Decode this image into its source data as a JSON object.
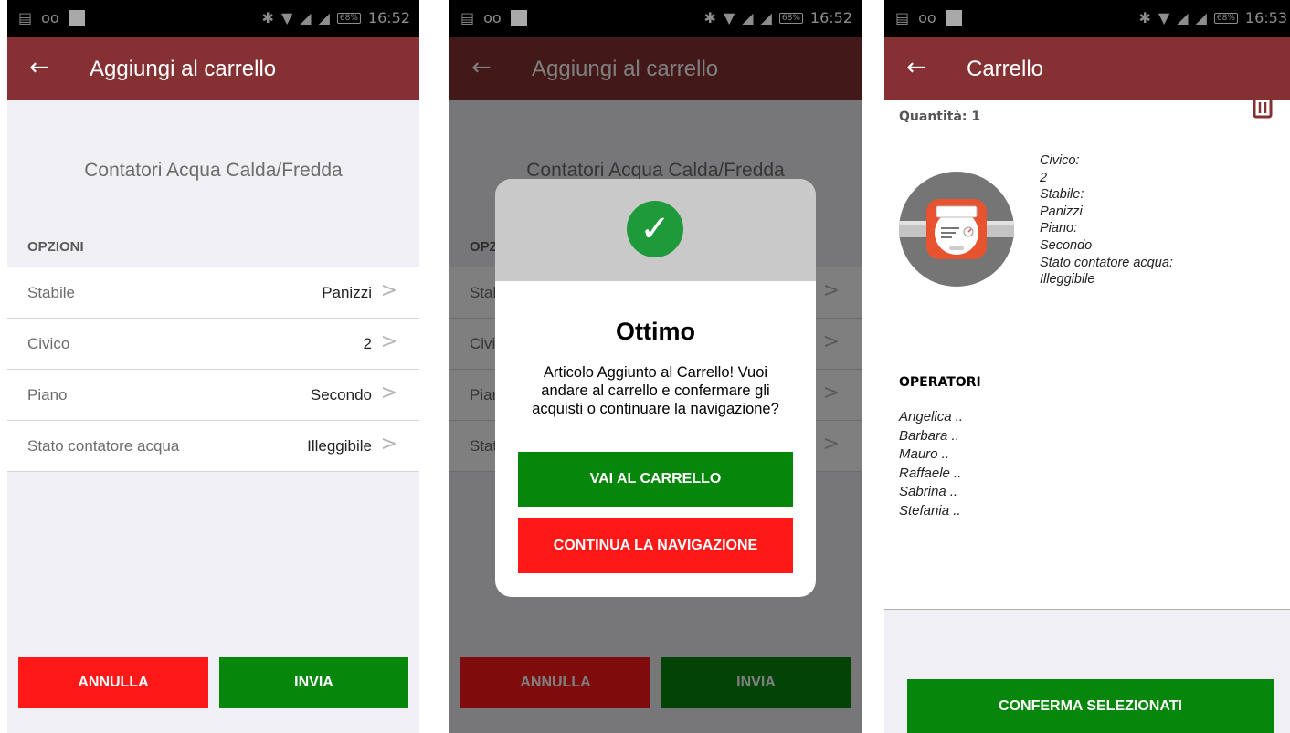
{
  "colors": {
    "appbar": "#853033",
    "red_button": "#ff1818",
    "green_button": "#07860c",
    "screen_bg": "#efeff4"
  },
  "status_bar": {
    "icons_left": [
      "calendar-icon",
      "voicemail-icon",
      "square-icon"
    ],
    "icons_right": [
      "bluetooth-icon",
      "wifi-icon",
      "signal-icon",
      "signal-icon",
      "battery-icon"
    ],
    "battery": "68%",
    "time_1": "16:52",
    "time_2": "16:52",
    "time_3": "16:53"
  },
  "screen1": {
    "title": "Aggiungi al carrello",
    "product_name": "Contatori Acqua Calda/Fredda",
    "section_header": "OPZIONI",
    "options": [
      {
        "label": "Stabile",
        "value": "Panizzi"
      },
      {
        "label": "Civico",
        "value": "2"
      },
      {
        "label": "Piano",
        "value": "Secondo"
      },
      {
        "label": "Stato contatore acqua",
        "value": "Illeggibile"
      }
    ],
    "cancel_label": "ANNULLA",
    "send_label": "INVIA"
  },
  "screen2": {
    "title": "Aggiungi al carrello",
    "product_name": "Contatori Acqua Calda/Fredda",
    "section_header_partial": "OPZI",
    "options_partial": [
      "Stal",
      "Civi",
      "Pian",
      "Stat"
    ],
    "dialog": {
      "title": "Ottimo",
      "message": "Articolo Aggiunto al Carrello! Vuoi andare al carrello e confermare gli acquisti o continuare la navigazione?",
      "go_to_cart_label": "VAI AL CARRELLO",
      "continue_label": "CONTINUA LA NAVIGAZIONE"
    },
    "cancel_label": "ANNULLA",
    "send_label": "INVIA"
  },
  "screen3": {
    "title": "Carrello",
    "quantity": "Quantità: 1",
    "details": [
      "Civico:",
      "2",
      "Stabile:",
      "Panizzi",
      "Piano:",
      "Secondo",
      "Stato contatore acqua:",
      "Illeggibile"
    ],
    "operators_header": "OPERATORI",
    "operators": [
      "Angelica ..",
      "Barbara ..",
      "Mauro ..",
      "Raffaele ..",
      "Sabrina ..",
      "Stefania .."
    ],
    "confirm_label": "CONFERMA SELEZIONATI"
  }
}
